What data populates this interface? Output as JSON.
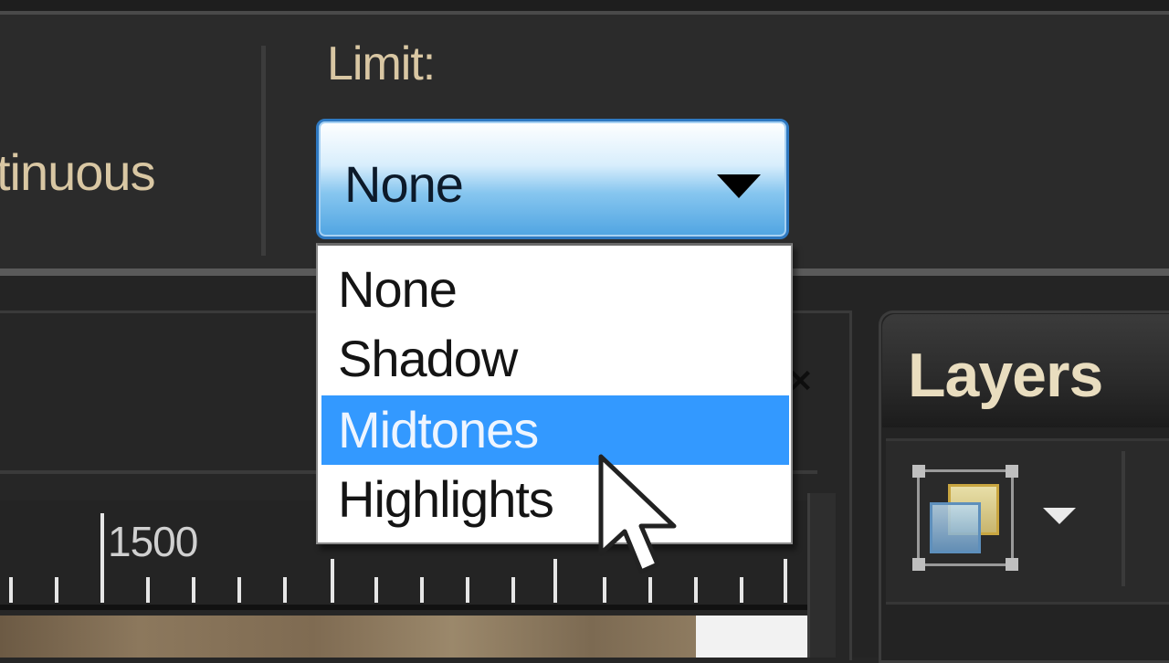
{
  "options_bar": {
    "contiguous_label": "tinuous",
    "limit_label": "Limit:",
    "limit_value": "None"
  },
  "limit_dropdown": {
    "options": [
      "None",
      "Shadow",
      "Midtones",
      "Highlights"
    ],
    "highlighted": "Midtones"
  },
  "ruler": {
    "label": "1500"
  },
  "layers_panel": {
    "title": "Layers",
    "mode_icon": "layer-blend-icon"
  },
  "colors": {
    "accent": "#3399ff",
    "label_text": "#d9c7a3",
    "background": "#262626"
  }
}
